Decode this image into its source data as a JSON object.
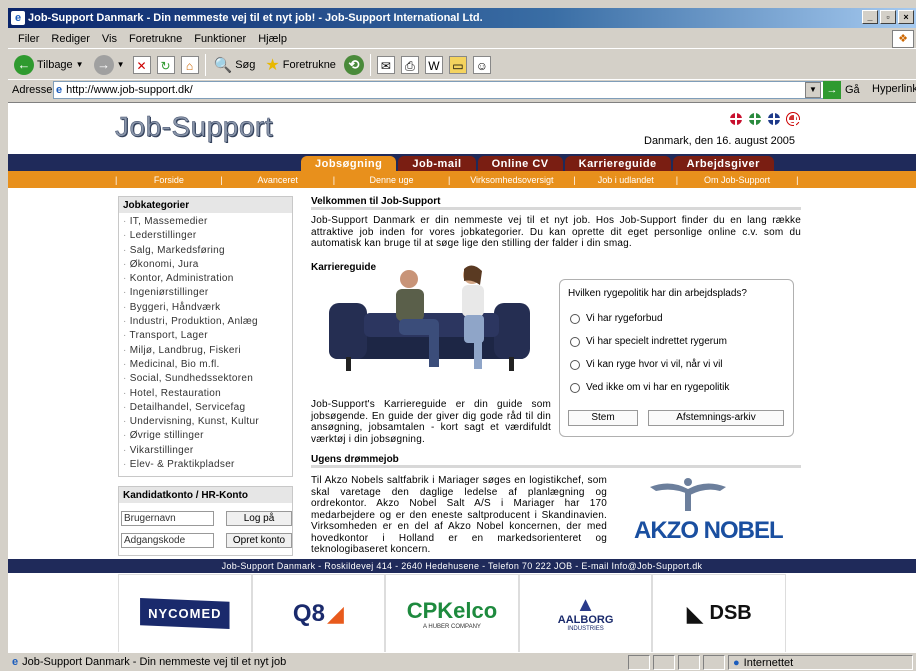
{
  "window": {
    "title": "Job-Support Danmark - Din nemmeste vej til et nyt job! - Job-Support International Ltd."
  },
  "menu": [
    "Filer",
    "Rediger",
    "Vis",
    "Foretrukne",
    "Funktioner",
    "Hjælp"
  ],
  "toolbar": {
    "back": "Tilbage",
    "search": "Søg",
    "favorites": "Foretrukne"
  },
  "address": {
    "label": "Adresse",
    "url": "http://www.job-support.dk/",
    "go": "Gå",
    "links": "Hyperlinks"
  },
  "site": {
    "logo": "Job-Support",
    "date": "Danmark, den 16. august 2005",
    "tabs": [
      "Jobsøgning",
      "Job-mail",
      "Online CV",
      "Karriereguide",
      "Arbejdsgiver"
    ],
    "subnav": [
      "Forside",
      "Avanceret",
      "Denne uge",
      "Virksomhedsoversigt",
      "Job i udlandet",
      "Om Job-Support"
    ],
    "categories_title": "Jobkategorier",
    "categories": [
      "IT, Massemedier",
      "Lederstillinger",
      "Salg, Markedsføring",
      "Økonomi, Jura",
      "Kontor, Administration",
      "Ingeniørstillinger",
      "Byggeri, Håndværk",
      "Industri, Produktion, Anlæg",
      "Transport, Lager",
      "Miljø, Landbrug, Fiskeri",
      "Medicinal, Bio m.fl.",
      "Social, Sundhedssektoren",
      "Hotel, Restauration",
      "Detailhandel, Servicefag",
      "Undervisning, Kunst, Kultur",
      "Øvrige stillinger",
      "Vikarstillinger",
      "Elev- & Praktikpladser"
    ],
    "login": {
      "title": "Kandidatkonto / HR-Konto",
      "username": "Brugernavn",
      "password": "Adgangskode",
      "login_btn": "Log på",
      "create_btn": "Opret konto"
    },
    "welcome": {
      "title": "Velkommen til Job-Support",
      "text": "Job-Support Danmark er din nemmeste vej til et nyt job. Hos Job-Support finder du en lang række attraktive job inden for vores jobkategorier. Du kan oprette dit eget personlige online c.v. som du automatisk kan bruge til at søge lige den stilling der falder i din smag."
    },
    "career": {
      "title": "Karriereguide",
      "text": "Job-Support's Karriereguide er din guide som jobsøgende. En guide der giver dig gode råd til din ansøgning, jobsamtalen - kort sagt et værdifuldt værktøj i din jobsøgning."
    },
    "poll": {
      "question": "Hvilken rygepolitik har din arbejdsplads?",
      "options": [
        "Vi har rygeforbud",
        "Vi har specielt indrettet rygerum",
        "Vi kan ryge hvor vi vil, når vi vil",
        "Ved ikke om vi har en rygepolitik"
      ],
      "vote": "Stem",
      "archive": "Afstemnings-arkiv"
    },
    "dream": {
      "title": "Ugens drømmejob",
      "text": "Til Akzo Nobels saltfabrik i Mariager søges en logistikchef, som skal varetage den daglige ledelse af planlægning og ordrekontor. Akzo Nobel Salt A/S i Mariager har 170 medarbejdere og er den eneste saltproducent i Skandinavien. Virksomheden er en del af Akzo Nobel koncernen, der med hovedkontor i Holland er en markedsorienteret og teknologibaseret koncern.",
      "logo": "AKZO NOBEL"
    },
    "footer": "Job-Support Danmark - Roskildevej 414 - 2640 Hedehusene - Telefon 70 222 JOB - E-mail Info@Job-Support.dk",
    "sponsors": [
      "NYCOMED",
      "Q8",
      "CPKelco",
      "AALBORG",
      "DSB"
    ],
    "sponsor_sub": {
      "cpkelco": "A HUBER COMPANY",
      "aalborg": "INDUSTRIES"
    }
  },
  "status": {
    "text": "Job-Support Danmark - Din nemmeste vej til et nyt job",
    "zone": "Internettet"
  }
}
